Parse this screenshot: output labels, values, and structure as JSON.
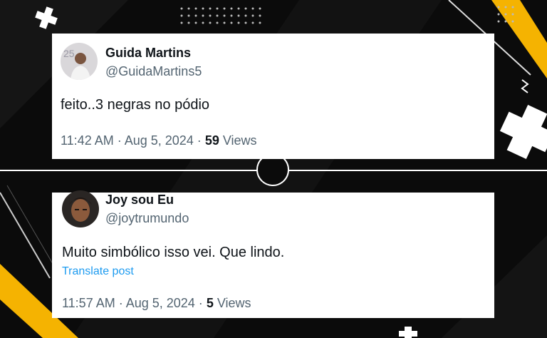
{
  "colors": {
    "background": "#0b0b0b",
    "accent_yellow": "#f5b301",
    "link": "#1d9bf0",
    "text_primary": "#0f1419",
    "text_secondary": "#536471"
  },
  "posts": [
    {
      "avatar_icon": "profile-photo",
      "name": "Guida Martins",
      "handle": "@GuidaMartins5",
      "text": "feito..3 negras no pódio",
      "time": "11:42 AM · Aug 5, 2024 · ",
      "views_count": "59",
      "views_label": " Views"
    },
    {
      "avatar_icon": "profile-photo",
      "name": "Joy sou Eu",
      "handle": "@joytrumundo",
      "text": "Muito simbólico isso vei. Que lindo.",
      "translate": "Translate post",
      "time": "11:57 AM · Aug 5, 2024 · ",
      "views_count": "5",
      "views_label": " Views"
    }
  ]
}
